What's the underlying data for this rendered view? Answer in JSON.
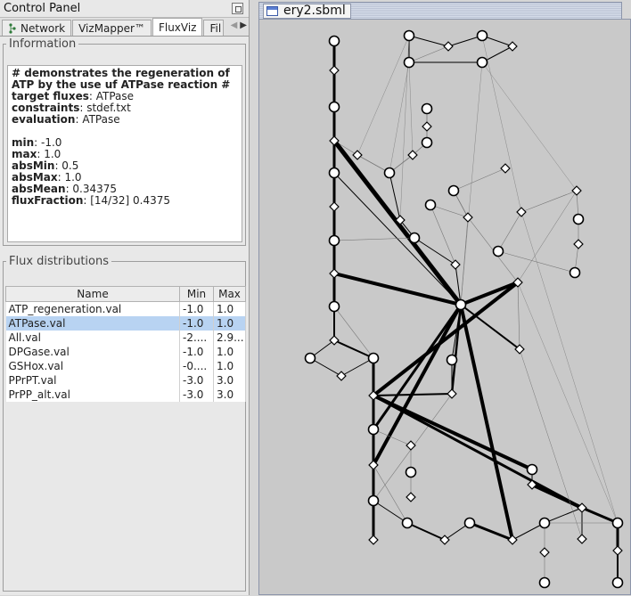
{
  "control_panel": {
    "title": "Control Panel",
    "tabs": [
      {
        "label": "Network",
        "active": false
      },
      {
        "label": "VizMapper™",
        "active": false
      },
      {
        "label": "FluxViz",
        "active": true
      },
      {
        "label": "Fil",
        "active": false
      }
    ]
  },
  "information": {
    "legend": "Information",
    "comment": "# demonstrates the regeneration of ATP by the use uf ATPase reaction #",
    "target_fluxes": {
      "key": "target fluxes",
      "value": "ATPase"
    },
    "constraints": {
      "key": "constraints",
      "value": "stdef.txt"
    },
    "evaluation": {
      "key": "evaluation",
      "value": "ATPase"
    },
    "min": {
      "key": "min",
      "value": "-1.0"
    },
    "max": {
      "key": "max",
      "value": "1.0"
    },
    "absMin": {
      "key": "absMin",
      "value": "0.5"
    },
    "absMax": {
      "key": "absMax",
      "value": "1.0"
    },
    "absMean": {
      "key": "absMean",
      "value": "0.34375"
    },
    "fluxFraction": {
      "key": "fluxFraction",
      "value": "[14/32] 0.4375"
    }
  },
  "flux_distributions": {
    "legend": "Flux distributions",
    "columns": [
      "Name",
      "Min",
      "Max"
    ],
    "rows": [
      {
        "name": "ATP_regeneration.val",
        "min": "-1.0",
        "max": "1.0",
        "selected": false
      },
      {
        "name": "ATPase.val",
        "min": "-1.0",
        "max": "1.0",
        "selected": true
      },
      {
        "name": "All.val",
        "min": "-2....",
        "max": "2.9...",
        "selected": false
      },
      {
        "name": "DPGase.val",
        "min": "-1.0",
        "max": "1.0",
        "selected": false
      },
      {
        "name": "GSHox.val",
        "min": "-0....",
        "max": "1.0",
        "selected": false
      },
      {
        "name": "PPrPT.val",
        "min": "-3.0",
        "max": "3.0",
        "selected": false
      },
      {
        "name": "PrPP_alt.val",
        "min": "-3.0",
        "max": "3.0",
        "selected": false
      }
    ]
  },
  "network_view": {
    "title": "ery2.sbml"
  }
}
